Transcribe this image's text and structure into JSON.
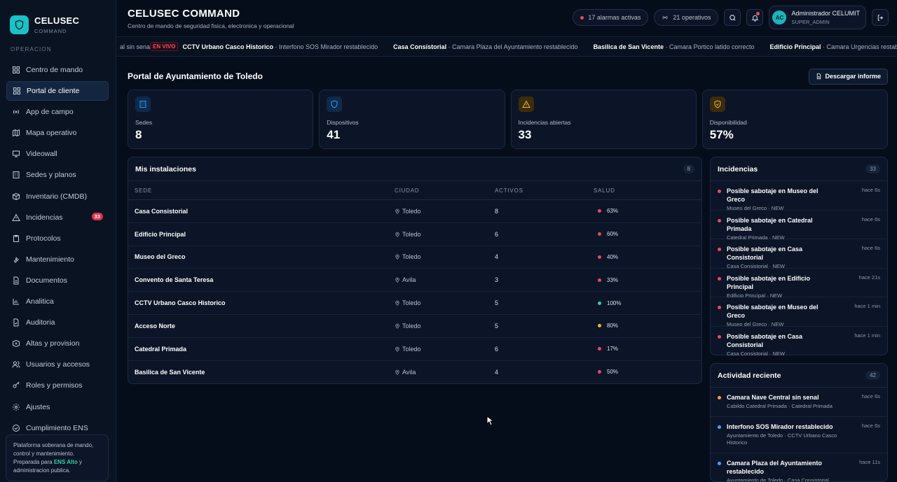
{
  "brand": {
    "name": "CELUSEC",
    "sub": "COMMAND"
  },
  "sidebar": {
    "section": "OPERACION",
    "items": [
      {
        "label": "Centro de mando",
        "icon": "grid-icon",
        "name": "sidebar-item-centro-de-mando"
      },
      {
        "label": "Portal de cliente",
        "icon": "grid-icon",
        "name": "sidebar-item-portal-de-cliente",
        "active": true
      },
      {
        "label": "App de campo",
        "icon": "radio-icon",
        "name": "sidebar-item-app-de-campo"
      },
      {
        "label": "Mapa operativo",
        "icon": "map-icon",
        "name": "sidebar-item-mapa-operativo"
      },
      {
        "label": "Videowall",
        "icon": "monitor-icon",
        "name": "sidebar-item-videowall"
      },
      {
        "label": "Sedes y planos",
        "icon": "building-icon",
        "name": "sidebar-item-sedes-y-planos"
      },
      {
        "label": "Inventario (CMDB)",
        "icon": "box-icon",
        "name": "sidebar-item-inventario"
      },
      {
        "label": "Incidencias",
        "icon": "warning-icon",
        "name": "sidebar-item-incidencias",
        "badge": "33"
      },
      {
        "label": "Protocolos",
        "icon": "clipboard-icon",
        "name": "sidebar-item-protocolos"
      },
      {
        "label": "Mantenimiento",
        "icon": "wrench-icon",
        "name": "sidebar-item-mantenimiento"
      },
      {
        "label": "Documentos",
        "icon": "document-icon",
        "name": "sidebar-item-documentos"
      },
      {
        "label": "Analitica",
        "icon": "chart-icon",
        "name": "sidebar-item-analitica"
      },
      {
        "label": "Auditoria",
        "icon": "audit-icon",
        "name": "sidebar-item-auditoria"
      },
      {
        "label": "Altas y provision",
        "icon": "plus-box-icon",
        "name": "sidebar-item-altas-y-provision"
      },
      {
        "label": "Usuarios y accesos",
        "icon": "users-icon",
        "name": "sidebar-item-usuarios-y-accesos"
      },
      {
        "label": "Roles y permisos",
        "icon": "key-icon",
        "name": "sidebar-item-roles-y-permisos"
      },
      {
        "label": "Ajustes",
        "icon": "gear-icon",
        "name": "sidebar-item-ajustes"
      },
      {
        "label": "Cumplimiento ENS",
        "icon": "check-circle-icon",
        "name": "sidebar-item-cumplimiento-ens"
      }
    ],
    "note_pre": "Plataforma soberana de mando, control y mantenimiento. Preparada para ",
    "note_hl": "ENS Alto",
    "note_post": " y administracion publica."
  },
  "header": {
    "title": "CELUSEC COMMAND",
    "subtitle": "Centro de mando de seguridad fisica, electronica y operacional",
    "alarms": "17 alarmas activas",
    "operators": "21 operativos",
    "user_initials": "AC",
    "user_name": "Administrador CELUMIT",
    "user_role": "SUPER_ADMIN"
  },
  "ticker": {
    "lead": "al sin senal",
    "live": "EN VIVO",
    "items": [
      {
        "site": "CCTV Urbano Casco Historico",
        "msg": " · Interfono SOS Mirador restablecido"
      },
      {
        "site": "Casa Consistorial",
        "msg": " · Camara Plaza del Ayuntamiento restablecido"
      },
      {
        "site": "Basilica de San Vicente",
        "msg": " · Camara Portico latido correcto"
      },
      {
        "site": "Edificio Principal",
        "msg": " · Camara Urgencias restablecido"
      },
      {
        "site": "Edificio P",
        "msg": ""
      }
    ]
  },
  "portal": {
    "title": "Portal de Ayuntamiento de Toledo",
    "download": "Descargar informe"
  },
  "stats": [
    {
      "label": "Sedes",
      "value": "8",
      "icon": "building-icon",
      "color": "#2e9cff",
      "bg": "#0f2a4a"
    },
    {
      "label": "Dispositivos",
      "value": "41",
      "icon": "shield-icon",
      "color": "#2e9cff",
      "bg": "#0f2a4a"
    },
    {
      "label": "Incidencias abiertas",
      "value": "33",
      "icon": "warning-icon",
      "color": "#f0b429",
      "bg": "#3a2c0c"
    },
    {
      "label": "Disponibilidad",
      "value": "57%",
      "icon": "shield-check-icon",
      "color": "#f0b429",
      "bg": "#3a2c0c"
    }
  ],
  "installs": {
    "title": "Mis instalaciones",
    "count": "8",
    "columns": [
      "SEDE",
      "CIUDAD",
      "ACTIVOS",
      "SALUD"
    ],
    "rows": [
      {
        "sede": "Casa Consistorial",
        "ciudad": "Toledo",
        "activos": "8",
        "salud": "63%",
        "color": "#e84b5f"
      },
      {
        "sede": "Edificio Principal",
        "ciudad": "Toledo",
        "activos": "6",
        "salud": "60%",
        "color": "#e84b5f"
      },
      {
        "sede": "Museo del Greco",
        "ciudad": "Toledo",
        "activos": "4",
        "salud": "40%",
        "color": "#e84b5f"
      },
      {
        "sede": "Convento de Santa Teresa",
        "ciudad": "Avila",
        "activos": "3",
        "salud": "33%",
        "color": "#e84b5f"
      },
      {
        "sede": "CCTV Urbano Casco Historico",
        "ciudad": "Toledo",
        "activos": "5",
        "salud": "100%",
        "color": "#2fd3a4"
      },
      {
        "sede": "Acceso Norte",
        "ciudad": "Toledo",
        "activos": "5",
        "salud": "80%",
        "color": "#f0b429"
      },
      {
        "sede": "Catedral Primada",
        "ciudad": "Toledo",
        "activos": "6",
        "salud": "17%",
        "color": "#e84b5f"
      },
      {
        "sede": "Basilica de San Vicente",
        "ciudad": "Avila",
        "activos": "4",
        "salud": "50%",
        "color": "#e84b5f"
      }
    ]
  },
  "incidents": {
    "title": "Incidencias",
    "count": "33",
    "items": [
      {
        "title": "Posible sabotaje en Museo del Greco",
        "sub": "Museo del Greco · NEW",
        "time": "hace 6s"
      },
      {
        "title": "Posible sabotaje en Catedral Primada",
        "sub": "Catedral Primada · NEW",
        "time": "hace 6s"
      },
      {
        "title": "Posible sabotaje en Casa Consistorial",
        "sub": "Casa Consistorial · NEW",
        "time": "hace 6s"
      },
      {
        "title": "Posible sabotaje en Edificio Principal",
        "sub": "Edificio Principal · NEW",
        "time": "hace 21s"
      },
      {
        "title": "Posible sabotaje en Museo del Greco",
        "sub": "Museo del Greco · NEW",
        "time": "hace 1 min"
      },
      {
        "title": "Posible sabotaje en Casa Consistorial",
        "sub": "Casa Consistorial · NEW",
        "time": "hace 1 min"
      }
    ]
  },
  "activity": {
    "title": "Actividad reciente",
    "count": "42",
    "items": [
      {
        "title": "Camara Nave Central sin senal",
        "sub": "Cabildo Catedral Primada · Catedral Primada",
        "time": "hace 6s",
        "color": "#f0a23a"
      },
      {
        "title": "Interfono SOS Mirador restablecido",
        "sub": "Ayuntamiento de Toledo · CCTV Urbano Casco Historico",
        "time": "hace 6s",
        "color": "#4aa3ff"
      },
      {
        "title": "Camara Plaza del Ayuntamiento restablecido",
        "sub": "Ayuntamiento de Toledo · Casa Consistorial",
        "time": "hace 11s",
        "color": "#4aa3ff"
      }
    ]
  }
}
